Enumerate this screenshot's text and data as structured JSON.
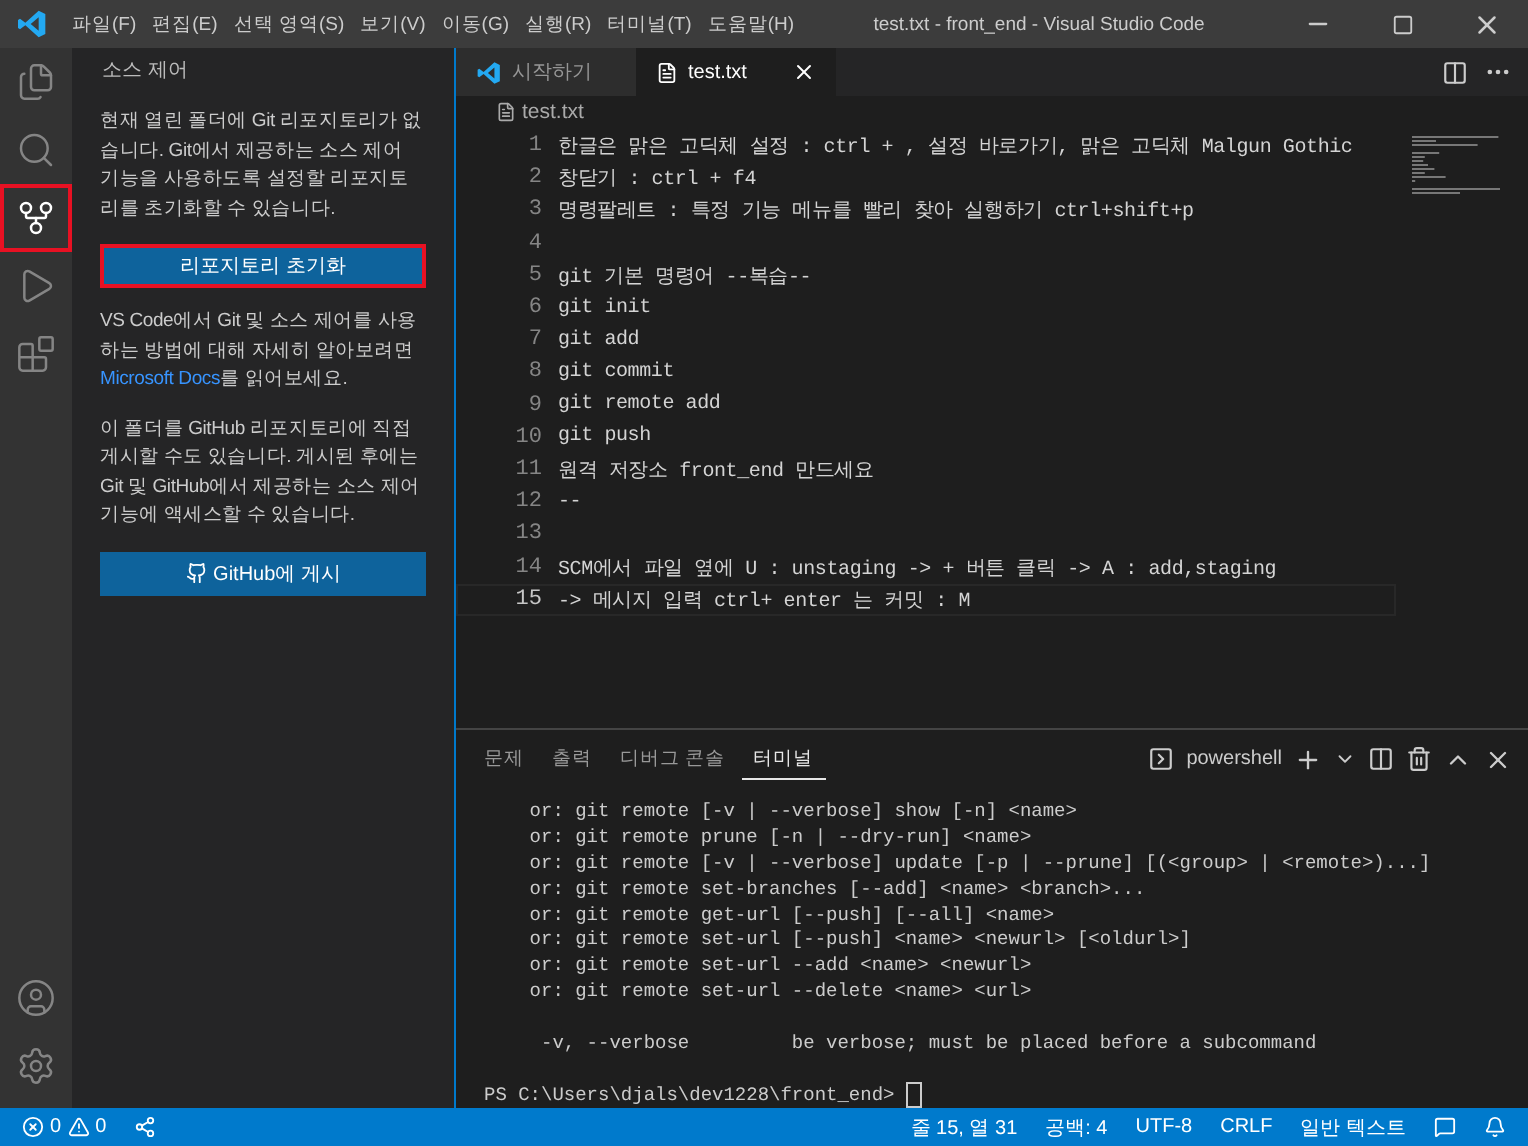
{
  "window": {
    "title": "test.txt - front_end - Visual Studio Code",
    "menu": [
      "파일(F)",
      "편집(E)",
      "선택 영역(S)",
      "보기(V)",
      "이동(G)",
      "실행(R)",
      "터미널(T)",
      "도움말(H)"
    ]
  },
  "activity_bar": {
    "items": [
      {
        "kind": "explorer",
        "selected": false,
        "highlighted": false
      },
      {
        "kind": "search",
        "selected": false,
        "highlighted": false
      },
      {
        "kind": "scm",
        "selected": true,
        "highlighted": true
      },
      {
        "kind": "debug",
        "selected": false,
        "highlighted": false
      },
      {
        "kind": "extensions",
        "selected": false,
        "highlighted": false
      }
    ],
    "bottom": [
      {
        "kind": "account"
      },
      {
        "kind": "settings"
      }
    ]
  },
  "sidebar": {
    "title": "소스 제어",
    "intro": "현재 열린 폴더에 Git 리포지토리가 없습니다. Git에서 제공하는 소스 제어 기능을 사용하도록 설정할 리포지토리를 초기화할 수 있습니다.",
    "init_button": {
      "label": "리포지토리 초기화",
      "highlighted": true
    },
    "docs": {
      "before": "VS Code에서 Git 및 소스 제어를 사용하는 방법에 대해 자세히 알아보려면 ",
      "link": "Microsoft Docs",
      "after": "를 읽어보세요."
    },
    "publish_text": "이 폴더를 GitHub 리포지토리에 직접 게시할 수도 있습니다. 게시된 후에는 Git 및 GitHub에서 제공하는 소스 제어 기능에 액세스할 수 있습니다.",
    "publish_button": {
      "label": "GitHub에 게시"
    }
  },
  "tabs": [
    {
      "label": "시작하기",
      "kind": "welcome",
      "selected": false
    },
    {
      "label": "test.txt",
      "kind": "file",
      "selected": true
    }
  ],
  "breadcrumb": "test.txt",
  "editor": {
    "lines": [
      {
        "number": "1",
        "text": "한글은 맑은 고딕체 설정 : ctrl + , 설정 바로가기, 맑은 고딕체 Malgun Gothic",
        "current": false
      },
      {
        "number": "2",
        "text": "창닫기 : ctrl + f4",
        "current": false
      },
      {
        "number": "3",
        "text": "명령팔레트 : 특정 기능 메뉴를 빨리 찾아 실행하기 ctrl+shift+p",
        "current": false
      },
      {
        "number": "4",
        "current": false
      },
      {
        "number": "5",
        "text": "git 기본 명령어 --복습--",
        "current": false
      },
      {
        "number": "6",
        "text": "git init",
        "current": false
      },
      {
        "number": "7",
        "text": "git add",
        "current": false
      },
      {
        "number": "8",
        "text": "git commit",
        "current": false
      },
      {
        "number": "9",
        "text": "git remote add",
        "current": false
      },
      {
        "number": "10",
        "text": "git push",
        "current": false
      },
      {
        "number": "11",
        "text": "원격 저장소 front_end 만드세요",
        "current": false
      },
      {
        "number": "12",
        "text": "--",
        "current": false
      },
      {
        "number": "13",
        "current": false
      },
      {
        "number": "14",
        "text": "SCM에서 파일 옆에 U : unstaging -> + 버튼 클릭 -> A : add,staging",
        "current": false
      },
      {
        "number": "15",
        "text": "-> 메시지 입력 ctrl+ enter 는 커밋 : M",
        "current": true
      }
    ]
  },
  "panel": {
    "tabs": [
      {
        "label": "문제",
        "selected": false
      },
      {
        "label": "출력",
        "selected": false
      },
      {
        "label": "디버그 콘솔",
        "selected": false
      },
      {
        "label": "터미널",
        "selected": true
      }
    ],
    "shell": "powershell",
    "terminal_lines": [
      {
        "kind": "text",
        "text": "    or: git remote [-v | --verbose] show [-n] <name>"
      },
      {
        "kind": "text",
        "text": "    or: git remote prune [-n | --dry-run] <name>"
      },
      {
        "kind": "text",
        "text": "    or: git remote [-v | --verbose] update [-p | --prune] [(<group> | <remote>)...]"
      },
      {
        "kind": "text",
        "text": "    or: git remote set-branches [--add] <name> <branch>..."
      },
      {
        "kind": "text",
        "text": "    or: git remote get-url [--push] [--all] <name>"
      },
      {
        "kind": "text",
        "text": "    or: git remote set-url [--push] <name> <newurl> [<oldurl>]"
      },
      {
        "kind": "text",
        "text": "    or: git remote set-url --add <name> <newurl>"
      },
      {
        "kind": "text",
        "text": "    or: git remote set-url --delete <name> <url>"
      },
      {
        "kind": "blank"
      },
      {
        "kind": "text",
        "text": "     -v, --verbose         be verbose; must be placed before a subcommand"
      },
      {
        "kind": "blank"
      }
    ],
    "prompt": "PS C:\\Users\\djals\\dev1228\\front_end> "
  },
  "status_bar": {
    "errors": "0",
    "warnings": "0",
    "right": [
      "줄 15, 열 31",
      "공백: 4",
      "UTF-8",
      "CRLF",
      "일반 텍스트"
    ]
  }
}
